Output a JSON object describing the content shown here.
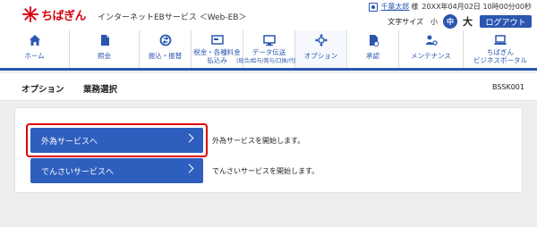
{
  "header": {
    "logo_text": "ちばぎん",
    "service_name": "インターネットEBサービス ＜Web-EB＞",
    "user_name": "千葉太郎",
    "user_suffix": "様",
    "login_time": "20XX年04月02日 10時00分00秒",
    "font_size_label": "文字サイズ",
    "font_small": "小",
    "font_medium": "中",
    "font_large": "大",
    "logout_label": "ログアウト",
    "brand_color": "#d7000f",
    "accent_color": "#2a56b0"
  },
  "nav": {
    "items": [
      {
        "label": "ホーム",
        "icon": "home-icon"
      },
      {
        "label": "照会",
        "icon": "document-icon"
      },
      {
        "label": "振込・振替",
        "icon": "transfer-icon"
      },
      {
        "label": "税金・各種料金",
        "label2": "払込み",
        "icon": "tax-payment-icon"
      },
      {
        "label": "データ伝送",
        "sub": "(総合/給与/賞与/口振/代振)",
        "icon": "data-transfer-icon"
      },
      {
        "label": "オプション",
        "icon": "option-icon"
      },
      {
        "label": "承認",
        "icon": "approval-icon"
      },
      {
        "label": "メンテナンス",
        "icon": "maintenance-icon"
      },
      {
        "label": "ちばぎん",
        "label2": "ビジネスポータル",
        "icon": "portal-icon"
      }
    ]
  },
  "page": {
    "title": "オプション",
    "subtitle": "業務選択",
    "screen_id": "BSSK001"
  },
  "options": [
    {
      "button": "外為サービスへ",
      "description": "外為サービスを開始します。"
    },
    {
      "button": "でんさいサービスへ",
      "description": "でんさいサービスを開始します。"
    }
  ]
}
